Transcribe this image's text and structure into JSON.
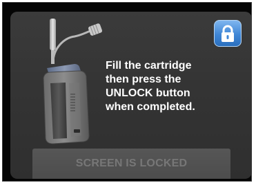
{
  "message": {
    "lines": [
      "Fill the cartridge",
      "then press the",
      "UNLOCK button",
      "when completed."
    ]
  },
  "lock_button": {
    "icon": "lock-icon"
  },
  "status_bar": {
    "label": "SCREEN IS LOCKED"
  },
  "colors": {
    "screen_background": "#343434",
    "lock_button": "#3f86d6",
    "status_bar": "#525252",
    "status_text": "#777777",
    "message_text": "#ffffff"
  }
}
